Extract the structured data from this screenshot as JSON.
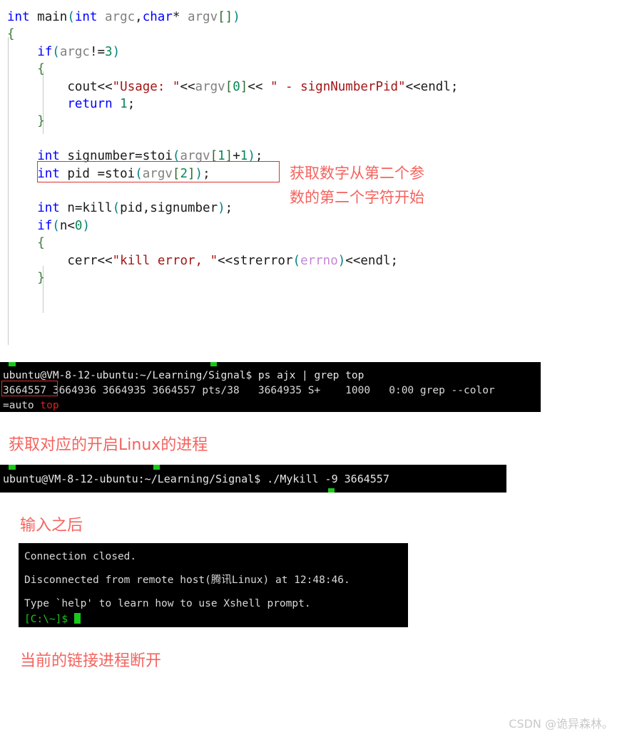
{
  "code": {
    "language": "C++",
    "highlight_box_line_index": 7,
    "lines": [
      {
        "indent": 0,
        "tokens": [
          {
            "t": "int",
            "c": "kw"
          },
          {
            "t": " ",
            "c": "plain"
          },
          {
            "t": "main",
            "c": "plain"
          },
          {
            "t": "(",
            "c": "punc"
          },
          {
            "t": "int",
            "c": "kw"
          },
          {
            "t": " ",
            "c": "plain"
          },
          {
            "t": "argc",
            "c": "id"
          },
          {
            "t": ",",
            "c": "plain"
          },
          {
            "t": "char",
            "c": "kw"
          },
          {
            "t": "*",
            "c": "plain"
          },
          {
            "t": " ",
            "c": "plain"
          },
          {
            "t": "argv",
            "c": "id"
          },
          {
            "t": "[",
            "c": "brk"
          },
          {
            "t": "]",
            "c": "brk"
          },
          {
            "t": ")",
            "c": "punc"
          }
        ]
      },
      {
        "indent": 0,
        "tokens": [
          {
            "t": "{",
            "c": "brace"
          }
        ]
      },
      {
        "indent": 4,
        "tokens": [
          {
            "t": "if",
            "c": "kw"
          },
          {
            "t": "(",
            "c": "punc"
          },
          {
            "t": "argc",
            "c": "id"
          },
          {
            "t": "!=",
            "c": "plain"
          },
          {
            "t": "3",
            "c": "num"
          },
          {
            "t": ")",
            "c": "punc"
          }
        ]
      },
      {
        "indent": 4,
        "tokens": [
          {
            "t": "{",
            "c": "brace"
          }
        ]
      },
      {
        "indent": 8,
        "tokens": [
          {
            "t": "cout",
            "c": "plain"
          },
          {
            "t": "<<",
            "c": "plain"
          },
          {
            "t": "\"Usage: \"",
            "c": "str"
          },
          {
            "t": "<<",
            "c": "plain"
          },
          {
            "t": "argv",
            "c": "id"
          },
          {
            "t": "[",
            "c": "brk"
          },
          {
            "t": "0",
            "c": "num"
          },
          {
            "t": "]",
            "c": "brk"
          },
          {
            "t": "<<",
            "c": "plain"
          },
          {
            "t": " \" - signNumberPid\"",
            "c": "str"
          },
          {
            "t": "<<",
            "c": "plain"
          },
          {
            "t": "endl",
            "c": "plain"
          },
          {
            "t": ";",
            "c": "plain"
          }
        ]
      },
      {
        "indent": 8,
        "tokens": [
          {
            "t": "return",
            "c": "kw"
          },
          {
            "t": " ",
            "c": "plain"
          },
          {
            "t": "1",
            "c": "num"
          },
          {
            "t": ";",
            "c": "plain"
          }
        ]
      },
      {
        "indent": 4,
        "tokens": [
          {
            "t": "}",
            "c": "brace"
          }
        ]
      },
      {
        "indent": 0,
        "tokens": []
      },
      {
        "indent": 4,
        "tokens": [
          {
            "t": "int",
            "c": "kw"
          },
          {
            "t": " ",
            "c": "plain"
          },
          {
            "t": "signumber",
            "c": "plain"
          },
          {
            "t": "=",
            "c": "plain"
          },
          {
            "t": "stoi",
            "c": "plain"
          },
          {
            "t": "(",
            "c": "punc"
          },
          {
            "t": "argv",
            "c": "id"
          },
          {
            "t": "[",
            "c": "brk"
          },
          {
            "t": "1",
            "c": "num"
          },
          {
            "t": "]",
            "c": "brk"
          },
          {
            "t": "+",
            "c": "plain"
          },
          {
            "t": "1",
            "c": "num"
          },
          {
            "t": ")",
            "c": "punc"
          },
          {
            "t": ";",
            "c": "plain"
          }
        ]
      },
      {
        "indent": 4,
        "tokens": [
          {
            "t": "int",
            "c": "kw"
          },
          {
            "t": " ",
            "c": "plain"
          },
          {
            "t": "pid ",
            "c": "plain"
          },
          {
            "t": "=",
            "c": "plain"
          },
          {
            "t": "stoi",
            "c": "plain"
          },
          {
            "t": "(",
            "c": "punc"
          },
          {
            "t": "argv",
            "c": "id"
          },
          {
            "t": "[",
            "c": "brk"
          },
          {
            "t": "2",
            "c": "num"
          },
          {
            "t": "]",
            "c": "brk"
          },
          {
            "t": ")",
            "c": "punc"
          },
          {
            "t": ";",
            "c": "plain"
          }
        ]
      },
      {
        "indent": 0,
        "tokens": []
      },
      {
        "indent": 4,
        "tokens": [
          {
            "t": "int",
            "c": "kw"
          },
          {
            "t": " ",
            "c": "plain"
          },
          {
            "t": "n",
            "c": "plain"
          },
          {
            "t": "=",
            "c": "plain"
          },
          {
            "t": "kill",
            "c": "plain"
          },
          {
            "t": "(",
            "c": "punc"
          },
          {
            "t": "pid",
            "c": "plain"
          },
          {
            "t": ",",
            "c": "plain"
          },
          {
            "t": "signumber",
            "c": "plain"
          },
          {
            "t": ")",
            "c": "punc"
          },
          {
            "t": ";",
            "c": "plain"
          }
        ]
      },
      {
        "indent": 4,
        "tokens": [
          {
            "t": "if",
            "c": "kw"
          },
          {
            "t": "(",
            "c": "punc"
          },
          {
            "t": "n",
            "c": "plain"
          },
          {
            "t": "<",
            "c": "plain"
          },
          {
            "t": "0",
            "c": "num"
          },
          {
            "t": ")",
            "c": "punc"
          }
        ]
      },
      {
        "indent": 4,
        "tokens": [
          {
            "t": "{",
            "c": "brace"
          }
        ]
      },
      {
        "indent": 8,
        "tokens": [
          {
            "t": "cerr",
            "c": "plain"
          },
          {
            "t": "<<",
            "c": "plain"
          },
          {
            "t": "\"kill error, \"",
            "c": "str"
          },
          {
            "t": "<<",
            "c": "plain"
          },
          {
            "t": "strerror",
            "c": "plain"
          },
          {
            "t": "(",
            "c": "punc"
          },
          {
            "t": "errno",
            "c": "macro"
          },
          {
            "t": ")",
            "c": "punc"
          },
          {
            "t": "<<",
            "c": "plain"
          },
          {
            "t": "endl",
            "c": "plain"
          },
          {
            "t": ";",
            "c": "plain"
          }
        ]
      },
      {
        "indent": 4,
        "tokens": [
          {
            "t": "}",
            "c": "brace"
          }
        ]
      }
    ]
  },
  "annotations": {
    "code_note": "获取数字从第二个参\n数的第二个字符开始",
    "ps_note": "获取对应的开启Linux的进程",
    "input_note": "输入之后",
    "disconnect_note": "当前的链接进程断开",
    "color": "#f4635e"
  },
  "terminals": {
    "ps": {
      "name": "ps-ajx-grep-top",
      "prompt": "ubuntu@VM-8-12-ubuntu:~/Learning/Signal$ ",
      "command": "ps ajx | grep top",
      "output_line_1": "3664557 3664936 3664935 3664557 pts/38   3664935 S+    1000   0:00 grep --color",
      "highlighted_pid": "3664557",
      "output_line_2_prefix": "=auto ",
      "output_line_2_match": "top",
      "match_color": "#e02020",
      "background": "#000000",
      "text_color": "#d8d8d8"
    },
    "mykill": {
      "name": "run-mykill",
      "prompt": "ubuntu@VM-8-12-ubuntu:~/Learning/Signal$ ",
      "command": "./Mykill -9 3664557",
      "background": "#000000",
      "text_color": "#e6e6e6"
    },
    "xshell": {
      "name": "xshell-disconnected",
      "lines": [
        "Connection closed.",
        "",
        "Disconnected from remote host(腾讯Linux) at 12:48:46.",
        "",
        "Type `help' to learn how to use Xshell prompt."
      ],
      "prompt": "[C:\\~]$ ",
      "prompt_color": "#19c819",
      "background": "#000000",
      "text_color": "#e6e6e6"
    }
  },
  "watermark": {
    "text": "CSDN @诡异森林。"
  }
}
